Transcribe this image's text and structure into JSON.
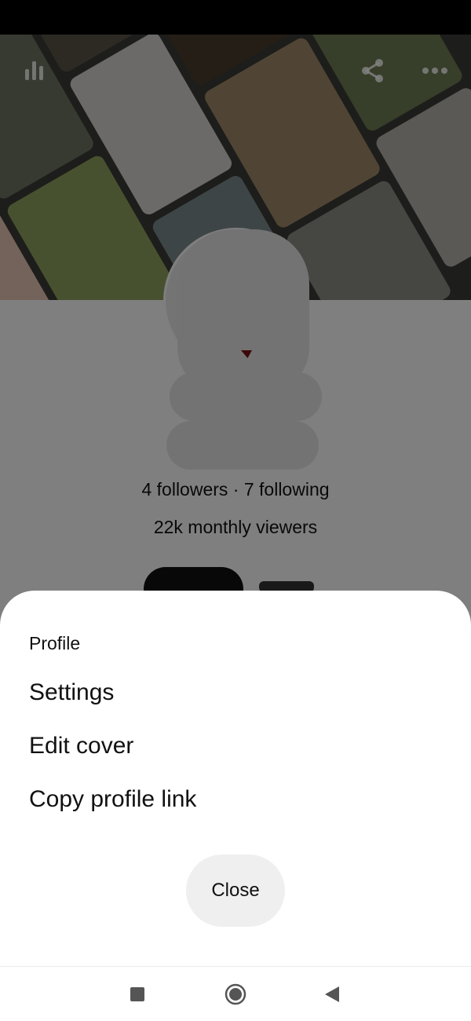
{
  "profile": {
    "followers_text": "4 followers · 7 following",
    "monthly_viewers": "22k monthly viewers"
  },
  "cover_actions": {
    "analytics_icon": "bar-chart-icon",
    "share_icon": "share-icon",
    "more_icon": "more-horizontal-icon"
  },
  "sheet": {
    "title": "Profile",
    "items": [
      {
        "label": "Settings"
      },
      {
        "label": "Edit cover"
      },
      {
        "label": "Copy profile link"
      }
    ],
    "close_label": "Close"
  },
  "nav": {
    "recents_icon": "square-icon",
    "home_icon": "circle-icon",
    "back_icon": "triangle-back-icon"
  },
  "colors": {
    "scrim": "#000000",
    "sheet_background": "#ffffff",
    "close_button": "#efefef",
    "text": "#111111"
  }
}
